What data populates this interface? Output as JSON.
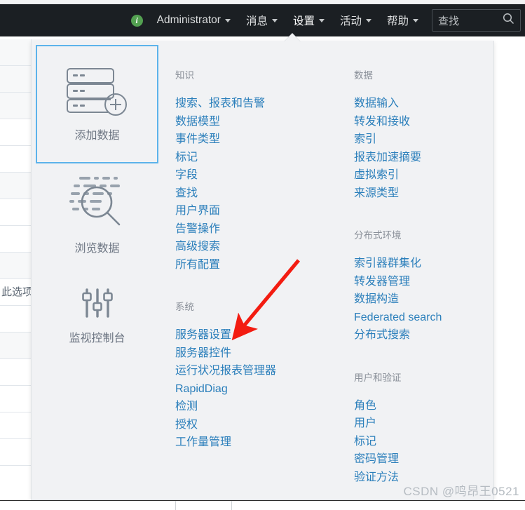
{
  "navbar": {
    "info_icon": "info-circle-icon",
    "items": [
      {
        "label": "Administrator",
        "has_caret": true,
        "active": false
      },
      {
        "label": "消息",
        "has_caret": true,
        "active": false
      },
      {
        "label": "设置",
        "has_caret": true,
        "active": true
      },
      {
        "label": "活动",
        "has_caret": true,
        "active": false
      },
      {
        "label": "帮助",
        "has_caret": true,
        "active": false
      }
    ],
    "search": {
      "placeholder": "查找",
      "value": "查找",
      "icon": "search-icon"
    }
  },
  "dropdown": {
    "tiles": [
      {
        "label": "添加数据",
        "icon": "server-stack-plus-icon",
        "selected": true
      },
      {
        "label": "浏览数据",
        "icon": "magnifier-data-icon",
        "selected": false
      },
      {
        "label": "监视控制台",
        "icon": "sliders-icon",
        "selected": false
      }
    ],
    "columns": [
      {
        "groups": [
          {
            "title": "知识",
            "links": [
              "搜索、报表和告警",
              "数据模型",
              "事件类型",
              "标记",
              "字段",
              "查找",
              "用户界面",
              "告警操作",
              "高级搜索",
              "所有配置"
            ]
          },
          {
            "title": "系统",
            "links": [
              "服务器设置",
              "服务器控件",
              "运行状况报表管理器",
              "RapidDiag",
              "检测",
              "授权",
              "工作量管理"
            ]
          }
        ]
      },
      {
        "groups": [
          {
            "title": "数据",
            "links": [
              "数据输入",
              "转发和接收",
              "索引",
              "报表加速摘要",
              "虚拟索引",
              "来源类型"
            ]
          },
          {
            "title": "分布式环境",
            "links": [
              "索引器群集化",
              "转发器管理",
              "数据构造",
              "Federated search",
              "分布式搜索"
            ]
          },
          {
            "title": "用户和验证",
            "links": [
              "角色",
              "用户",
              "标记",
              "密码管理",
              "验证方法"
            ]
          }
        ]
      }
    ]
  },
  "background": {
    "partial_cell_text": "此选项"
  },
  "annotation": {
    "arrow_color": "#f31c11",
    "arrow_label": "red-pointer-arrow"
  },
  "watermark": {
    "text": "CSDN @鸣昂王0521"
  },
  "colors": {
    "navbar_bg": "#1b1f23",
    "dropdown_bg": "#f1f2f4",
    "link": "#2b7fbb",
    "group_title": "#8a9099",
    "tile_label": "#6a7380",
    "selected_border": "#5cb3eb",
    "info_green": "#53a051",
    "arrow_red": "#f31c11"
  }
}
